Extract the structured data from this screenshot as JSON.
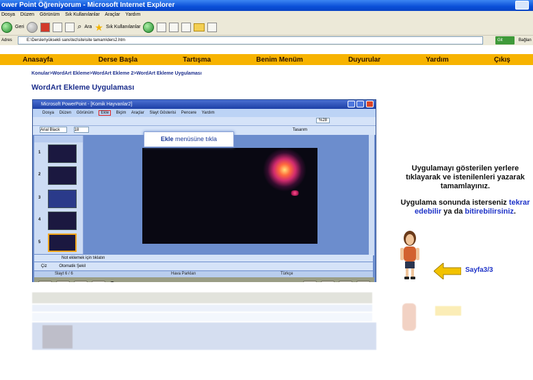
{
  "browser": {
    "title": "ower Point Öğreniyorum - Microsoft Internet Explorer",
    "menu": [
      "Dosya",
      "Düzen",
      "Görünüm",
      "Sık Kullanılanlar",
      "Araçlar",
      "Yardım"
    ],
    "back_label": "Geri",
    "search_label": "Ara",
    "favorites_label": "Sık Kullanılanlar",
    "address_label": "Adres",
    "address_value": "E:\\Dersler\\yüksekli sans\\tez\\site\\site tamam\\ders2.htm",
    "go_label": "Git",
    "links_label": "Bağlan"
  },
  "nav": {
    "items": [
      "Anasayfa",
      "Derse Başla",
      "Tartışma",
      "Benim Menüm",
      "Duyurular",
      "Yardım",
      "Çıkış"
    ]
  },
  "breadcrumb": "Konular>WordArt Ekleme>WordArt Ekleme 2>WordArt Ekleme Uygulaması",
  "page_title": "WordArt Ekleme Uygulaması",
  "powerpoint": {
    "title": "Microsoft PowerPoint - [Komik Hayvanlar2]",
    "menu": [
      "Dosya",
      "Düzen",
      "Görünüm",
      "Ekle",
      "Biçim",
      "Araçlar",
      "Slayt Gösterisi",
      "Pencere",
      "Yardım"
    ],
    "zoom": "%28",
    "font_name": "Arial Black",
    "font_size": "18",
    "design_label": "Tasarım",
    "tooltip_bold": "Ekle",
    "tooltip_rest": " menüsüne tıkla",
    "slide_numbers": [
      "1",
      "2",
      "3",
      "4",
      "5"
    ],
    "notes_placeholder": "Not eklemek için tıklatın",
    "draw_label": "Çiz",
    "autoshapes_label": "Otomatik Şekil",
    "status_slide": "Slayt 6 / 6",
    "status_design": "Hava Parkları",
    "status_lang": "Türkçe"
  },
  "instructions": {
    "para1": "Uygulamayı gösterilen yerlere tıklayarak ve istenilenleri yazarak tamamlayınız.",
    "para2_a": "Uygulama sonunda isterseniz ",
    "para2_link1": "tekrar edebilir",
    "para2_b": " ya da ",
    "para2_link2": "bitirebilirsiniz",
    "para2_c": "."
  },
  "pager": "Sayfa3/3",
  "colors": {
    "nav_bg": "#f7b300",
    "title_blue": "#1c2e8c",
    "link_blue": "#1f34c8"
  }
}
